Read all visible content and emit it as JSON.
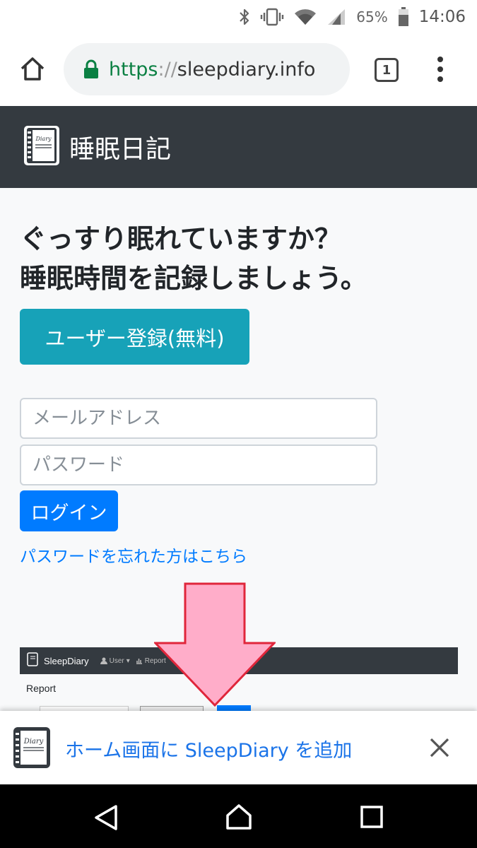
{
  "status_bar": {
    "battery_percent": "65%",
    "time": "14:06",
    "icons": [
      "bluetooth-icon",
      "vibrate-icon",
      "wifi-icon",
      "signal-icon",
      "battery-icon"
    ]
  },
  "browser": {
    "url_scheme": "https",
    "url_separator": "://",
    "url_host": "sleepdiary.info",
    "tab_count": "1",
    "icons": [
      "home-icon",
      "lock-icon",
      "more-vert-icon"
    ]
  },
  "site": {
    "brand_name": "睡眠日記",
    "logo_text": "Diary"
  },
  "main": {
    "headline_line1": "ぐっすり眠れていますか？",
    "headline_line2": "睡眠時間を記録しましょう。",
    "register_button": "ユーザー登録(無料)",
    "email_placeholder": "メールアドレス",
    "password_placeholder": "パスワード",
    "login_button": "ログイン",
    "forgot_link": "パスワードを忘れた方はこちら"
  },
  "preview": {
    "brand": "SleepDiary",
    "nav_user": "User",
    "nav_report": "Report",
    "page_title": "Report"
  },
  "banner": {
    "add_text": "ホーム画面に SleepDiary を追加",
    "icon_text": "Diary"
  },
  "colors": {
    "navbar": "#343a40",
    "primary": "#007bff",
    "info": "#17a2b8",
    "arrow_fill": "#ffadc9",
    "arrow_stroke": "#e0263b",
    "link_blue": "#1a73e8"
  },
  "android_nav": {
    "icons": [
      "back-icon",
      "home-icon",
      "recents-icon"
    ]
  }
}
